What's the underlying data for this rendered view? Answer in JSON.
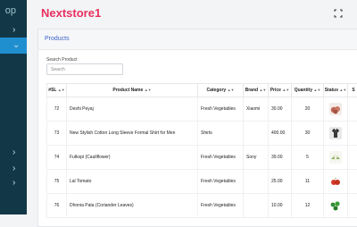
{
  "sidebar": {
    "logo_text": "op",
    "items": [
      {
        "chevron": "›",
        "active": false
      },
      {
        "chevron": "›",
        "active": true
      },
      {
        "chevron": "›",
        "active": false
      },
      {
        "chevron": "›",
        "active": false
      },
      {
        "chevron": "›",
        "active": false
      }
    ]
  },
  "header": {
    "brand": "Nextstore1",
    "fullscreen_icon": "expand-icon"
  },
  "products": {
    "title": "Products",
    "search_label": "Search Product",
    "search_placeholder": "Search",
    "columns": [
      "#SL",
      "Product Name",
      "Category",
      "Brand",
      "Price",
      "Quantity",
      "Status",
      "S"
    ],
    "rows": [
      {
        "sl": "72",
        "name": "Deshi Peyaj",
        "category": "Fresh Vegetables",
        "brand": "Xiaomi",
        "price": "30.00",
        "quantity": "20",
        "image": "onion-image",
        "image_color": "#b96552"
      },
      {
        "sl": "73",
        "name": "New Stylish Cotton Long Sleeve Formal Shirt for Men",
        "category": "Shirts",
        "brand": "",
        "price": "400.00",
        "quantity": "30",
        "image": "shirt-image",
        "image_color": "#3a3a3a"
      },
      {
        "sl": "74",
        "name": "Fulkopi (Cauliflower)",
        "category": "Fresh Vegetables",
        "brand": "Sony",
        "price": "39.00",
        "quantity": "5",
        "image": "cauliflower-image",
        "image_color": "#cfe3b0"
      },
      {
        "sl": "75",
        "name": "Lal Tomato",
        "category": "Fresh Vegetables",
        "brand": "",
        "price": "25.00",
        "quantity": "11",
        "image": "tomato-image",
        "image_color": "#d23a2a"
      },
      {
        "sl": "76",
        "name": "Dhonia Pata (Coriander Leaves)",
        "category": "Fresh Vegetables",
        "brand": "",
        "price": "10.00",
        "quantity": "12",
        "image": "coriander-image",
        "image_color": "#2f8a2f"
      }
    ]
  }
}
